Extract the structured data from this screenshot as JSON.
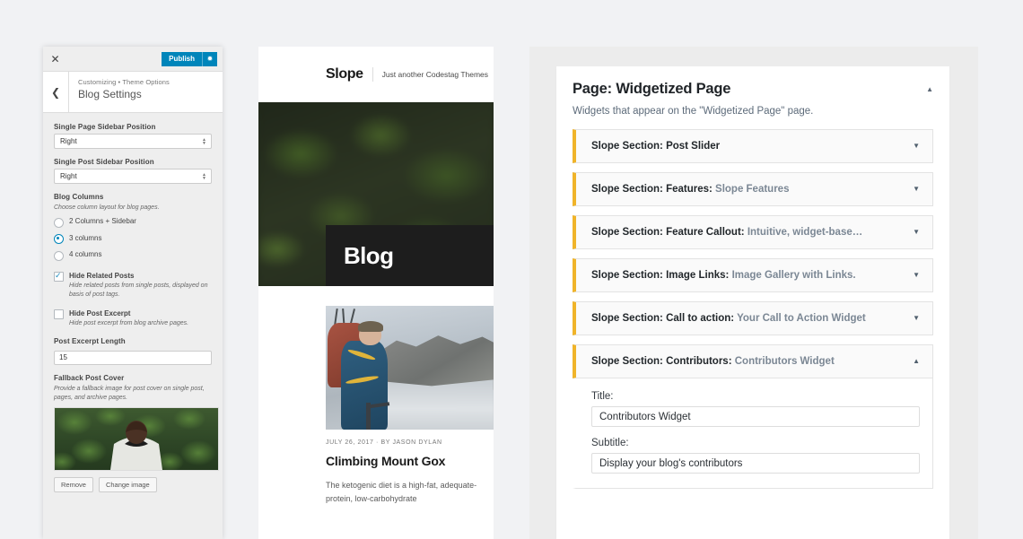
{
  "customizer": {
    "close_icon": "close-icon",
    "publish_label": "Publish",
    "gear_icon": "gear-icon",
    "back_icon": "chevron-left-icon",
    "breadcrumb": "Customizing • Theme Options",
    "title": "Blog Settings",
    "fields": {
      "single_page_sidebar": {
        "label": "Single Page Sidebar Position",
        "value": "Right"
      },
      "single_post_sidebar": {
        "label": "Single Post Sidebar Position",
        "value": "Right"
      },
      "blog_columns": {
        "label": "Blog Columns",
        "description": "Choose column layout for blog pages.",
        "options": [
          {
            "label": "2 Columns + Sidebar",
            "selected": false
          },
          {
            "label": "3 columns",
            "selected": true
          },
          {
            "label": "4 columns",
            "selected": false
          }
        ]
      },
      "hide_related_posts": {
        "label": "Hide Related Posts",
        "description": "Hide related posts from single posts, displayed on basis of post tags.",
        "checked": true
      },
      "hide_post_excerpt": {
        "label": "Hide Post Excerpt",
        "description": "Hide post excerpt from blog archive pages.",
        "checked": false
      },
      "post_excerpt_length": {
        "label": "Post Excerpt Length",
        "value": "15"
      },
      "fallback_post_cover": {
        "label": "Fallback Post Cover",
        "description": "Provide a fallback image for post cover on single post, pages, and archive pages.",
        "image_alt": "person-in-white-shirt-facing-forest",
        "remove_label": "Remove",
        "change_label": "Change image"
      }
    }
  },
  "preview": {
    "logo": "Slope",
    "tagline": "Just another Codestag Themes",
    "hero_title": "Blog",
    "hero_image_alt": "dark-green-forest-canopy",
    "post": {
      "thumb_alt": "mountain-climber-on-glacier",
      "meta": "JULY 26, 2017 · BY JASON DYLAN",
      "title": "Climbing Mount Gox",
      "excerpt": "The ketogenic diet is a high-fat, adequate-protein, low-carbohydrate"
    }
  },
  "widgets_panel": {
    "title": "Page: Widgetized Page",
    "description": "Widgets that appear on the \"Widgetized Page\" page.",
    "collapse_icon": "chevron-up-icon",
    "accent_color": "#f0b429",
    "items": [
      {
        "prefix": "Slope Section: Post Slider",
        "name": "",
        "expanded": false,
        "caret": "chevron-down-icon"
      },
      {
        "prefix": "Slope Section: Features: ",
        "name": "Slope Features",
        "expanded": false,
        "caret": "chevron-down-icon"
      },
      {
        "prefix": "Slope Section: Feature Callout: ",
        "name": "Intuitive, widget-base…",
        "expanded": false,
        "caret": "chevron-down-icon"
      },
      {
        "prefix": "Slope Section: Image Links: ",
        "name": "Image Gallery with Links.",
        "expanded": false,
        "caret": "chevron-down-icon"
      },
      {
        "prefix": "Slope Section: Call to action: ",
        "name": "Your Call to Action Widget",
        "expanded": false,
        "caret": "chevron-down-icon"
      },
      {
        "prefix": "Slope Section: Contributors: ",
        "name": "Contributors Widget",
        "expanded": true,
        "caret": "chevron-up-icon"
      }
    ],
    "expanded_form": {
      "title_label": "Title:",
      "title_value": "Contributors Widget",
      "subtitle_label": "Subtitle:",
      "subtitle_value": "Display your blog's contributors"
    }
  }
}
